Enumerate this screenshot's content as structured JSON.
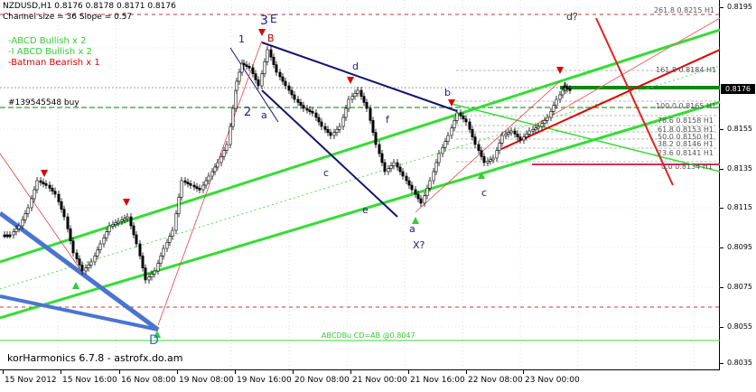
{
  "header": {
    "symbol_line": "NZDUSD,H1  0.8176 0.8178 0.8171 0.8176",
    "channel_line": "Channel size = 36 Slope = 0.57"
  },
  "legend": [
    {
      "text": "-ABCD Bullish x 2",
      "color": "#33cc33"
    },
    {
      "text": "-I ABCD Bullish x 2",
      "color": "#33cc33"
    },
    {
      "text": "-Batman Bearish x 1",
      "color": "#dd0000"
    }
  ],
  "order_label": "#139545548 buy",
  "footer": "korHarmonics 6.7.8 - astrofx.do.am",
  "abcd_label": "ABCDBu CD=AB   @0.8047",
  "current_price": "0.8176",
  "colors": {
    "green": "#33dd33",
    "red": "#dd0000",
    "navy": "#15156e",
    "blue": "#4a74d0",
    "candle": "#000000"
  },
  "y_axis": {
    "ticks": [
      "0.8195",
      "0.8176",
      "0.8155",
      "0.8135",
      "0.8115",
      "0.8095",
      "0.8075",
      "0.8055",
      "0.8035"
    ]
  },
  "x_axis": {
    "ticks": [
      "15 Nov 2012",
      "15 Nov 16:00",
      "16 Nov 08:00",
      "19 Nov 08:00",
      "19 Nov 16:00",
      "20 Nov 08:00",
      "21 Nov 00:00",
      "21 Nov 16:00",
      "22 Nov 08:00",
      "23 Nov 00:00"
    ]
  },
  "fib_levels": [
    "261.8 0.8215 H1",
    "161.8 0.8184 H1",
    "100.0 0.8165 H1",
    "78.6 0.8158 H1",
    "61.8 0.8153 H1",
    "50.0 0.8150 H1",
    "38.2 0.8146 H1",
    "23.6 0.8141 H1",
    "0.0 0.8134 H1"
  ],
  "wave_labels": [
    "3",
    "E",
    "1",
    "B",
    "2",
    "a",
    "d",
    "b",
    "c",
    "f",
    "e",
    "a",
    "X?",
    "c",
    "d?",
    "D"
  ]
}
